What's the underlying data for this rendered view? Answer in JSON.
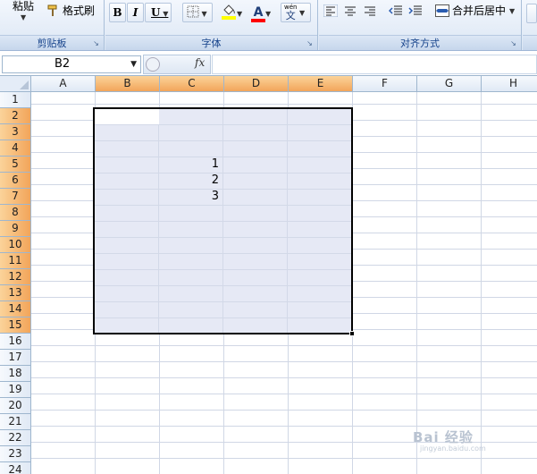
{
  "ribbon": {
    "clipboard": {
      "label": "剪贴板",
      "paste": "粘贴",
      "format_painter": "格式刷"
    },
    "font": {
      "label": "字体",
      "bold": "B",
      "italic": "I",
      "underline": "U",
      "font_color_letter": "A",
      "phonetic_top": "wén",
      "phonetic_bottom": "文"
    },
    "alignment": {
      "label": "对齐方式",
      "merge_center": "合并后居中"
    },
    "colors": {
      "highlight": "#ffff00",
      "font_color": "#ff0000"
    }
  },
  "formula_bar": {
    "name_box": "B2",
    "fx": "fx",
    "formula": ""
  },
  "columns": [
    "A",
    "B",
    "C",
    "D",
    "E",
    "F",
    "G",
    "H"
  ],
  "selected_columns": [
    "B",
    "C",
    "D",
    "E"
  ],
  "rows": [
    "1",
    "2",
    "3",
    "4",
    "5",
    "6",
    "7",
    "8",
    "9",
    "10",
    "11",
    "12",
    "13",
    "14",
    "15",
    "16",
    "17",
    "18",
    "19",
    "20",
    "21",
    "22",
    "23",
    "24"
  ],
  "selected_rows": [
    "2",
    "3",
    "4",
    "5",
    "6",
    "7",
    "8",
    "9",
    "10",
    "11",
    "12",
    "13",
    "14",
    "15"
  ],
  "selection": {
    "range": "B2:E15",
    "active_cell": "B2"
  },
  "cells": [
    {
      "ref": "C5",
      "value": "1"
    },
    {
      "ref": "C6",
      "value": "2"
    },
    {
      "ref": "C7",
      "value": "3"
    }
  ],
  "watermark": {
    "text": "Bai 经验",
    "sub": "jingyan.baidu.com"
  }
}
